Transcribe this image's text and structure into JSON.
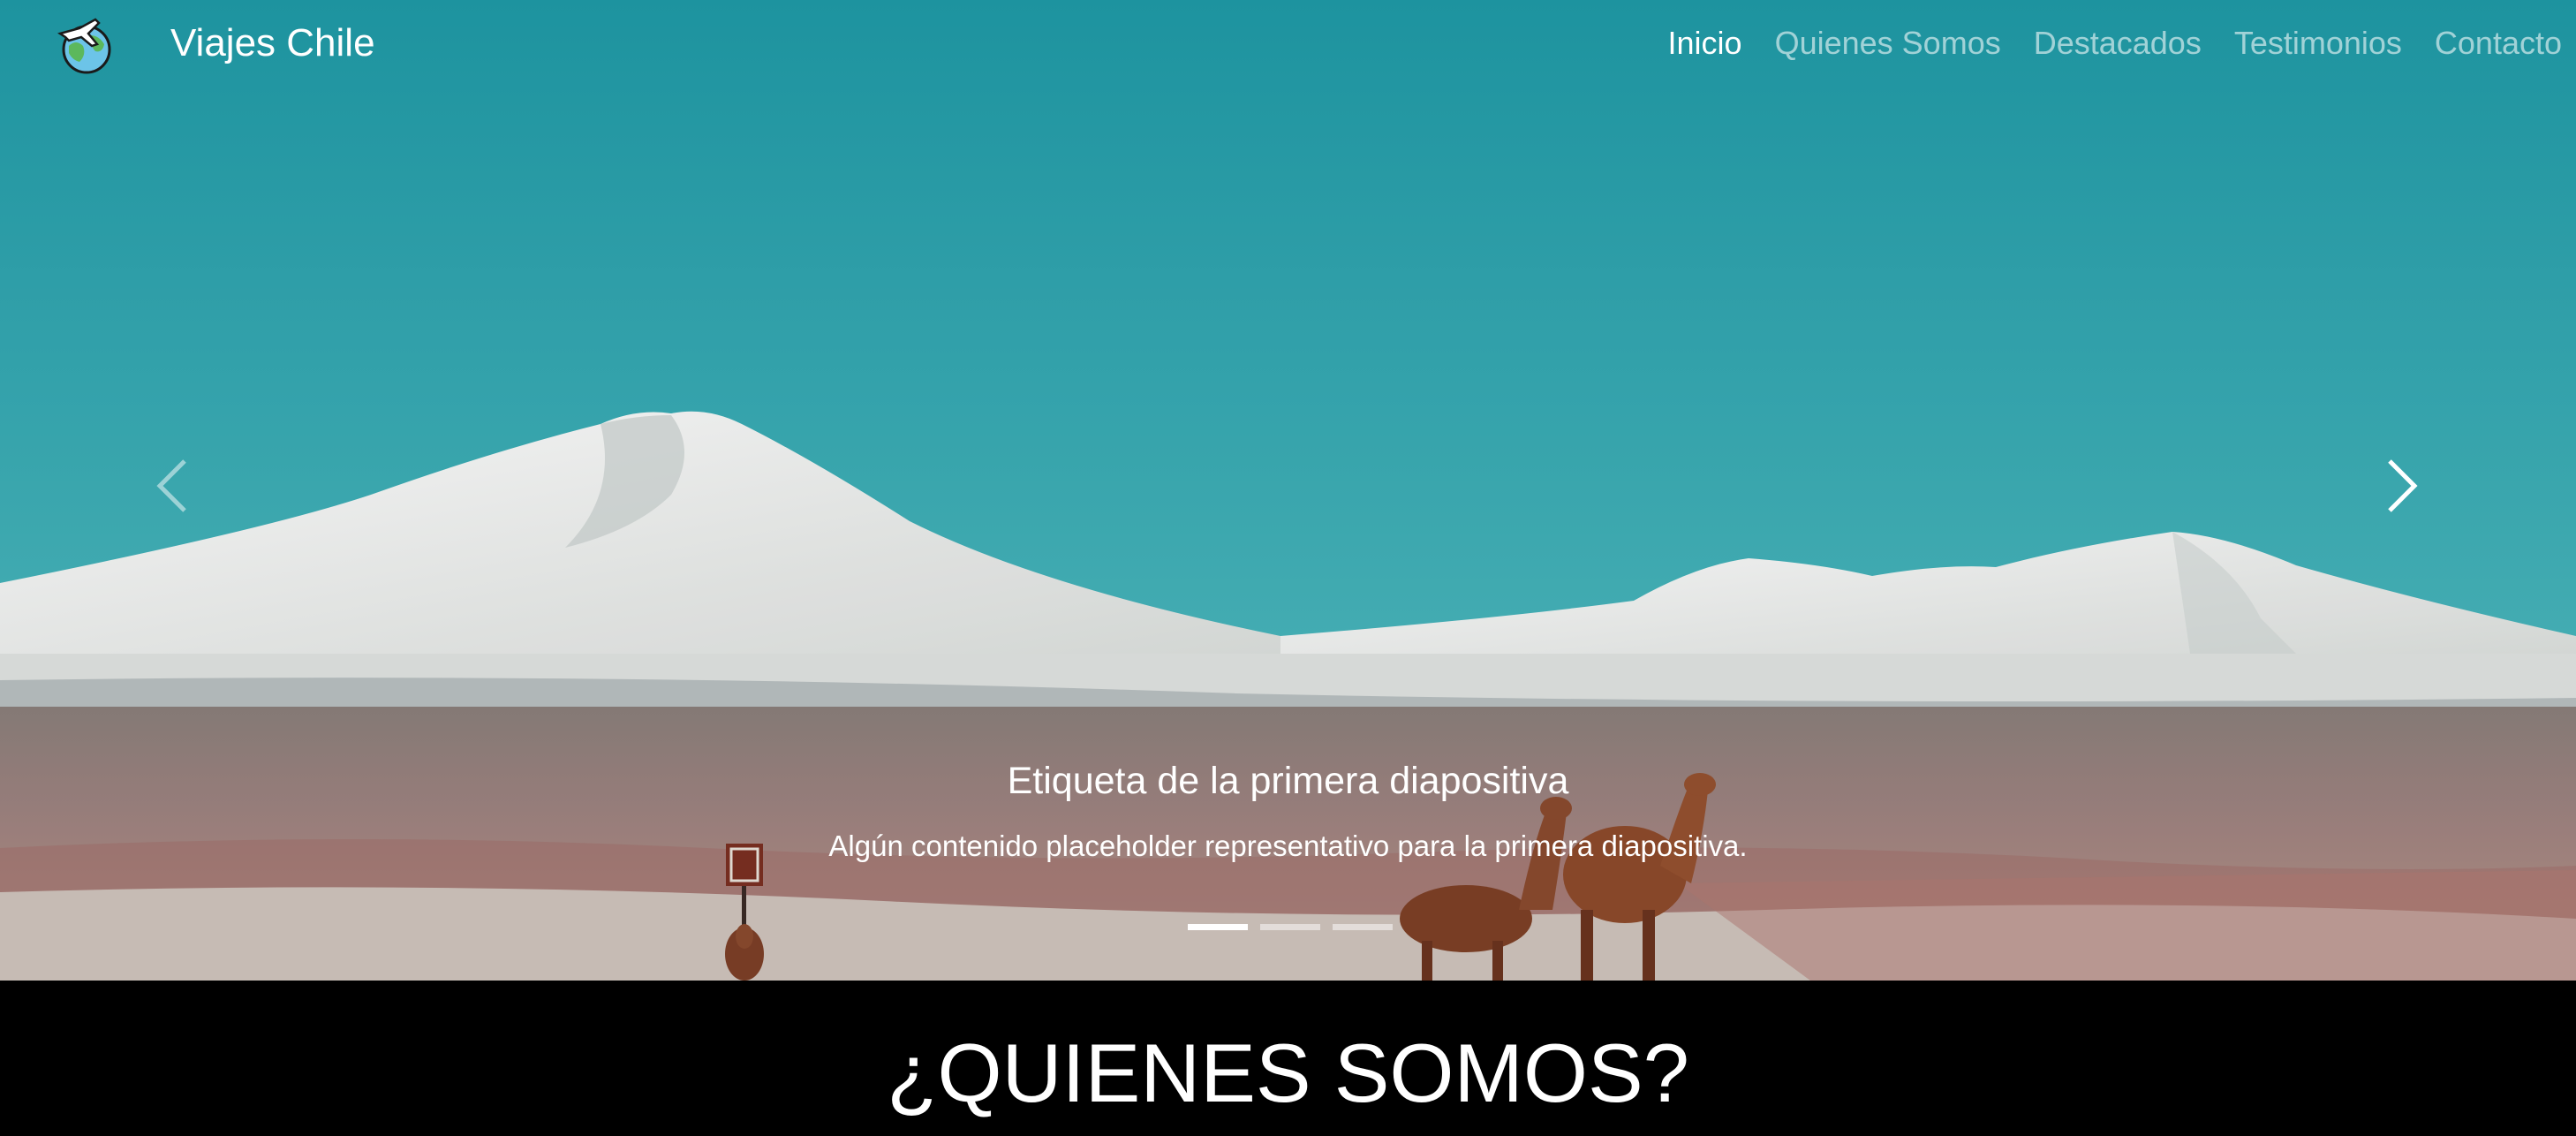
{
  "brand": {
    "name": "Viajes Chile",
    "logo_icon": "globe-airplane-icon"
  },
  "nav": {
    "items": [
      {
        "label": "Inicio",
        "active": true
      },
      {
        "label": "Quienes Somos",
        "active": false
      },
      {
        "label": "Destacados",
        "active": false
      },
      {
        "label": "Testimonios",
        "active": false
      },
      {
        "label": "Contacto",
        "active": false
      }
    ]
  },
  "carousel": {
    "slide_count": 3,
    "active_index": 0,
    "caption_title": "Etiqueta de la primera diapositiva",
    "caption_text": "Algún contenido placeholder representativo para la primera diapositiva.",
    "prev_icon": "chevron-left-icon",
    "next_icon": "chevron-right-icon",
    "image_subject": "snow-capped volcanoes with llamas on the altiplano"
  },
  "about": {
    "title": "¿QUIENES SOMOS?"
  },
  "colors": {
    "sky": "#2fa6b2",
    "snow": "#f1efea",
    "ground": "#9a7f7b",
    "llama": "#8a4a2e",
    "background": "#000000",
    "text": "#ffffff"
  }
}
